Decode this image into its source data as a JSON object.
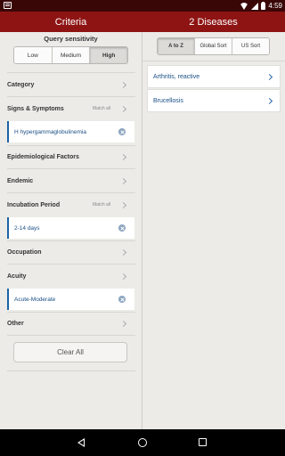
{
  "status_bar": {
    "time": "4:59"
  },
  "header": {
    "left_title": "Criteria",
    "right_title": "2 Diseases"
  },
  "criteria": {
    "sensitivity": {
      "title": "Query sensitivity",
      "options": [
        "Low",
        "Medium",
        "High"
      ],
      "selected": "High"
    },
    "category": {
      "label": "Category"
    },
    "signs_symptoms": {
      "label": "Signs & Symptoms",
      "match": "Match all",
      "chip": "H hypergammaglobulinemia"
    },
    "epidemiological": {
      "label": "Epidemiological Factors"
    },
    "endemic": {
      "label": "Endemic"
    },
    "incubation": {
      "label": "Incubation Period",
      "match": "Match all",
      "chip": "2-14 days"
    },
    "occupation": {
      "label": "Occupation"
    },
    "acuity": {
      "label": "Acuity",
      "chip": "Acute-Moderate"
    },
    "other": {
      "label": "Other"
    },
    "clear_all": "Clear All"
  },
  "results": {
    "sort": {
      "options": [
        "A to Z",
        "Global Sort",
        "US Sort"
      ],
      "selected": "A to Z"
    },
    "diseases": [
      "Arthritis, reactive",
      "Brucellosis"
    ]
  },
  "colors": {
    "header": "#8e1414",
    "status_bar": "#3a0707",
    "link": "#1a4f86",
    "chip_accent": "#1a63a6"
  }
}
